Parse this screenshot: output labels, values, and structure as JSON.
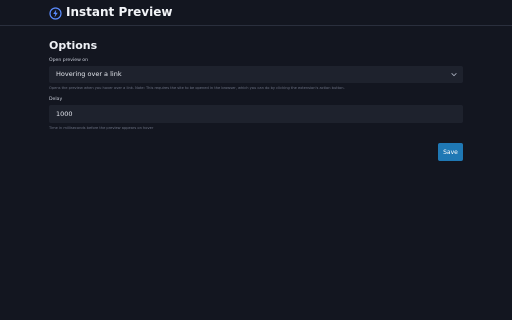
{
  "app": {
    "title": "Instant Preview",
    "logo_icon": "lightning-bolt-icon",
    "accent": "#5b8cff"
  },
  "options": {
    "heading": "Options",
    "open_preview": {
      "label": "Open preview on",
      "selected": "Hovering over a link",
      "help": "Opens the preview when you hover over a link. Note: This requires the site to be opened in the browser, which you can do by clicking the extension's action button."
    },
    "delay": {
      "label": "Delay",
      "value": "1000",
      "help": "Time in milliseconds before the preview appears on hover"
    },
    "save_label": "Save",
    "save_color": "#1f78b4"
  }
}
